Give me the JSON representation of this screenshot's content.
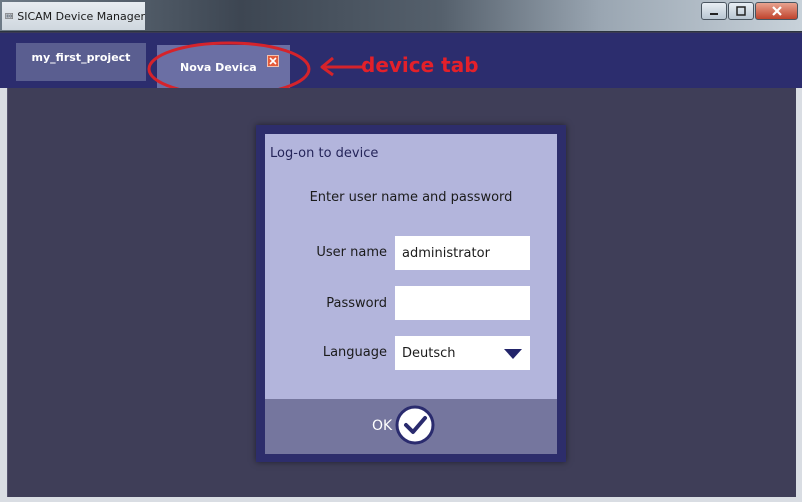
{
  "window": {
    "title": "SICAM Device Manager"
  },
  "tabs": [
    {
      "label": "my_first_project",
      "active": false
    },
    {
      "label": "Nova Devica",
      "active": true,
      "closable": true
    }
  ],
  "annotation": {
    "text": "device tab",
    "color": "#e3202a"
  },
  "dialog": {
    "title": "Log-on to device",
    "subtitle": "Enter user name and password",
    "fields": {
      "username": {
        "label": "User name",
        "value": "administrator"
      },
      "password": {
        "label": "Password",
        "value": ""
      },
      "language": {
        "label": "Language",
        "value": "Deutsch"
      }
    },
    "ok_label": "OK"
  },
  "colors": {
    "tab_band": "#2c2d6e",
    "background": "#3f3e58",
    "dialog_panel": "#b3b5dc",
    "dialog_footer": "#75769e"
  },
  "icons": {
    "app": "sicam-app-icon",
    "tab_close": "close-icon",
    "dropdown": "chevron-down-icon",
    "ok": "checkmark-icon"
  }
}
